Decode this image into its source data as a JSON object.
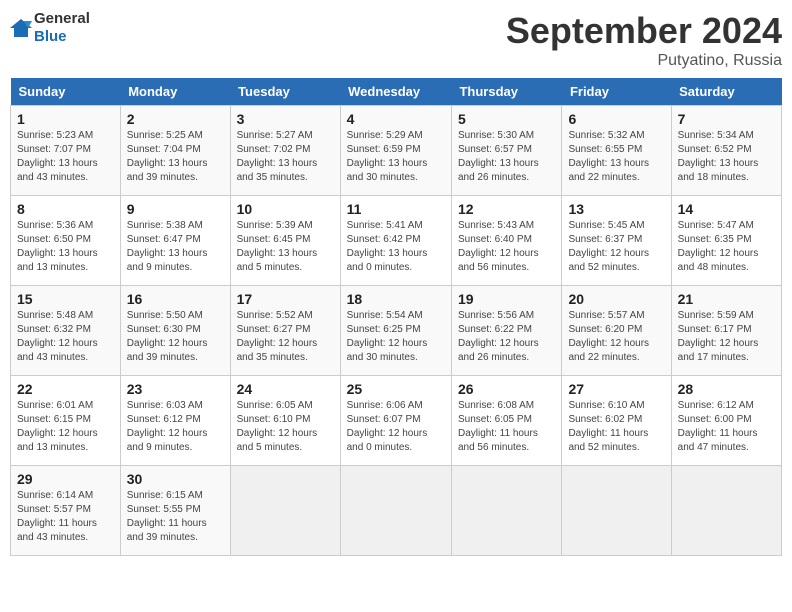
{
  "logo": {
    "general": "General",
    "blue": "Blue"
  },
  "header": {
    "month": "September 2024",
    "location": "Putyatino, Russia"
  },
  "weekdays": [
    "Sunday",
    "Monday",
    "Tuesday",
    "Wednesday",
    "Thursday",
    "Friday",
    "Saturday"
  ],
  "weeks": [
    [
      {
        "day": "1",
        "sunrise": "5:23 AM",
        "sunset": "7:07 PM",
        "daylight": "13 hours and 43 minutes."
      },
      {
        "day": "2",
        "sunrise": "5:25 AM",
        "sunset": "7:04 PM",
        "daylight": "13 hours and 39 minutes."
      },
      {
        "day": "3",
        "sunrise": "5:27 AM",
        "sunset": "7:02 PM",
        "daylight": "13 hours and 35 minutes."
      },
      {
        "day": "4",
        "sunrise": "5:29 AM",
        "sunset": "6:59 PM",
        "daylight": "13 hours and 30 minutes."
      },
      {
        "day": "5",
        "sunrise": "5:30 AM",
        "sunset": "6:57 PM",
        "daylight": "13 hours and 26 minutes."
      },
      {
        "day": "6",
        "sunrise": "5:32 AM",
        "sunset": "6:55 PM",
        "daylight": "13 hours and 22 minutes."
      },
      {
        "day": "7",
        "sunrise": "5:34 AM",
        "sunset": "6:52 PM",
        "daylight": "13 hours and 18 minutes."
      }
    ],
    [
      {
        "day": "8",
        "sunrise": "5:36 AM",
        "sunset": "6:50 PM",
        "daylight": "13 hours and 13 minutes."
      },
      {
        "day": "9",
        "sunrise": "5:38 AM",
        "sunset": "6:47 PM",
        "daylight": "13 hours and 9 minutes."
      },
      {
        "day": "10",
        "sunrise": "5:39 AM",
        "sunset": "6:45 PM",
        "daylight": "13 hours and 5 minutes."
      },
      {
        "day": "11",
        "sunrise": "5:41 AM",
        "sunset": "6:42 PM",
        "daylight": "13 hours and 0 minutes."
      },
      {
        "day": "12",
        "sunrise": "5:43 AM",
        "sunset": "6:40 PM",
        "daylight": "12 hours and 56 minutes."
      },
      {
        "day": "13",
        "sunrise": "5:45 AM",
        "sunset": "6:37 PM",
        "daylight": "12 hours and 52 minutes."
      },
      {
        "day": "14",
        "sunrise": "5:47 AM",
        "sunset": "6:35 PM",
        "daylight": "12 hours and 48 minutes."
      }
    ],
    [
      {
        "day": "15",
        "sunrise": "5:48 AM",
        "sunset": "6:32 PM",
        "daylight": "12 hours and 43 minutes."
      },
      {
        "day": "16",
        "sunrise": "5:50 AM",
        "sunset": "6:30 PM",
        "daylight": "12 hours and 39 minutes."
      },
      {
        "day": "17",
        "sunrise": "5:52 AM",
        "sunset": "6:27 PM",
        "daylight": "12 hours and 35 minutes."
      },
      {
        "day": "18",
        "sunrise": "5:54 AM",
        "sunset": "6:25 PM",
        "daylight": "12 hours and 30 minutes."
      },
      {
        "day": "19",
        "sunrise": "5:56 AM",
        "sunset": "6:22 PM",
        "daylight": "12 hours and 26 minutes."
      },
      {
        "day": "20",
        "sunrise": "5:57 AM",
        "sunset": "6:20 PM",
        "daylight": "12 hours and 22 minutes."
      },
      {
        "day": "21",
        "sunrise": "5:59 AM",
        "sunset": "6:17 PM",
        "daylight": "12 hours and 17 minutes."
      }
    ],
    [
      {
        "day": "22",
        "sunrise": "6:01 AM",
        "sunset": "6:15 PM",
        "daylight": "12 hours and 13 minutes."
      },
      {
        "day": "23",
        "sunrise": "6:03 AM",
        "sunset": "6:12 PM",
        "daylight": "12 hours and 9 minutes."
      },
      {
        "day": "24",
        "sunrise": "6:05 AM",
        "sunset": "6:10 PM",
        "daylight": "12 hours and 5 minutes."
      },
      {
        "day": "25",
        "sunrise": "6:06 AM",
        "sunset": "6:07 PM",
        "daylight": "12 hours and 0 minutes."
      },
      {
        "day": "26",
        "sunrise": "6:08 AM",
        "sunset": "6:05 PM",
        "daylight": "11 hours and 56 minutes."
      },
      {
        "day": "27",
        "sunrise": "6:10 AM",
        "sunset": "6:02 PM",
        "daylight": "11 hours and 52 minutes."
      },
      {
        "day": "28",
        "sunrise": "6:12 AM",
        "sunset": "6:00 PM",
        "daylight": "11 hours and 47 minutes."
      }
    ],
    [
      {
        "day": "29",
        "sunrise": "6:14 AM",
        "sunset": "5:57 PM",
        "daylight": "11 hours and 43 minutes."
      },
      {
        "day": "30",
        "sunrise": "6:15 AM",
        "sunset": "5:55 PM",
        "daylight": "11 hours and 39 minutes."
      },
      null,
      null,
      null,
      null,
      null
    ]
  ],
  "labels": {
    "sunrise": "Sunrise: ",
    "sunset": "Sunset: ",
    "daylight": "Daylight: "
  }
}
